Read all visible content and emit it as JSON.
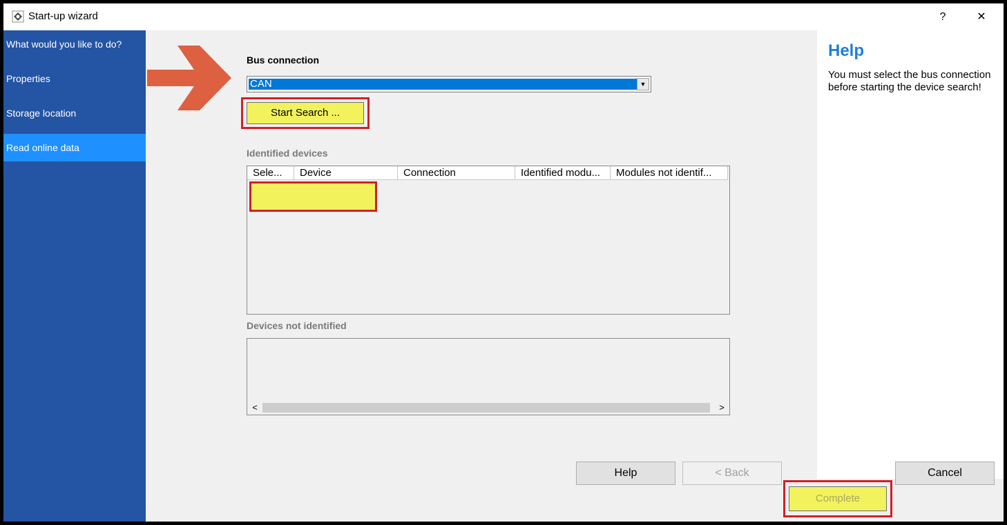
{
  "window": {
    "title": "Start-up wizard",
    "help_glyph": "?",
    "close_glyph": "✕"
  },
  "sidebar": {
    "items": [
      {
        "label": "What would you like to do?",
        "active": false
      },
      {
        "label": "Properties",
        "active": false
      },
      {
        "label": "Storage location",
        "active": false
      },
      {
        "label": "Read online data",
        "active": true
      }
    ]
  },
  "main": {
    "bus_connection_label": "Bus connection",
    "bus_connection_value": "CAN",
    "start_search_label": "Start Search ...",
    "identified_devices_label": "Identified devices",
    "identified_columns": [
      "Sele...",
      "Device",
      "Connection",
      "Identified modu...",
      "Modules not identif..."
    ],
    "not_identified_label": "Devices not identified",
    "scroll_left_glyph": "<",
    "scroll_right_glyph": ">"
  },
  "help": {
    "title": "Help",
    "text": "You must select the bus connection before starting the device search!"
  },
  "footer": {
    "help_label": "Help",
    "back_label": "< Back",
    "complete_label": "Complete",
    "cancel_label": "Cancel"
  },
  "colors": {
    "sidebar": "#2454a4",
    "sidebar_active": "#1e90ff",
    "highlight_yellow": "#f2f25c",
    "highlight_red": "#d21f26",
    "arrow": "#dd6040",
    "help_title": "#1e7fd8"
  },
  "icons": [
    "app-icon",
    "dropdown-arrow-icon",
    "arrow-pointer-icon"
  ]
}
